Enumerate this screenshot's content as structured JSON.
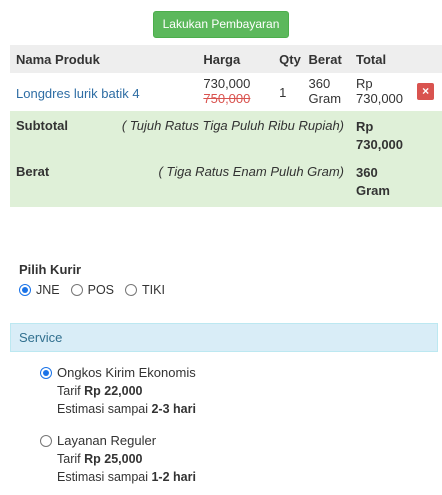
{
  "pay_button": "Lakukan Pembayaran",
  "table": {
    "headers": {
      "product": "Nama Produk",
      "price": "Harga",
      "qty": "Qty",
      "weight": "Berat",
      "total": "Total"
    },
    "item": {
      "name": "Longdres lurik batik 4",
      "price_new": "730,000",
      "price_old": "750,000",
      "qty": "1",
      "weight_value": "360",
      "weight_unit": "Gram",
      "total_currency": "Rp",
      "total_value": "730,000",
      "delete_icon": "×"
    },
    "subtotal": {
      "label": "Subtotal",
      "words": "( Tujuh Ratus Tiga Puluh Ribu Rupiah)",
      "value_currency": "Rp",
      "value_amount": "730,000"
    },
    "berat": {
      "label": "Berat",
      "words": "( Tiga Ratus Enam Puluh Gram)",
      "value_amount": "360",
      "value_unit": "Gram"
    }
  },
  "kurir": {
    "title": "Pilih Kurir",
    "options": [
      "JNE",
      "POS",
      "TIKI"
    ],
    "selected": "JNE"
  },
  "service": {
    "title": "Service",
    "options": [
      {
        "name": "Ongkos Kirim Ekonomis",
        "tarif_label": "Tarif",
        "tarif_value": "Rp 22,000",
        "estimasi_label": "Estimasi sampai",
        "estimasi_value": "2-3 hari",
        "selected": true
      },
      {
        "name": "Layanan Reguler",
        "tarif_label": "Tarif",
        "tarif_value": "Rp 25,000",
        "estimasi_label": "Estimasi sampai",
        "estimasi_value": "1-2 hari",
        "selected": false
      }
    ]
  },
  "colors": {
    "pay_button": "#5cb85c",
    "link": "#2e6da4",
    "strike_price": "#d9534f",
    "summary_bg": "#dff0d8",
    "service_bg": "#d9edf7",
    "radio_selected": "#1a73e8"
  },
  "icons": {
    "delete": "times-icon"
  }
}
